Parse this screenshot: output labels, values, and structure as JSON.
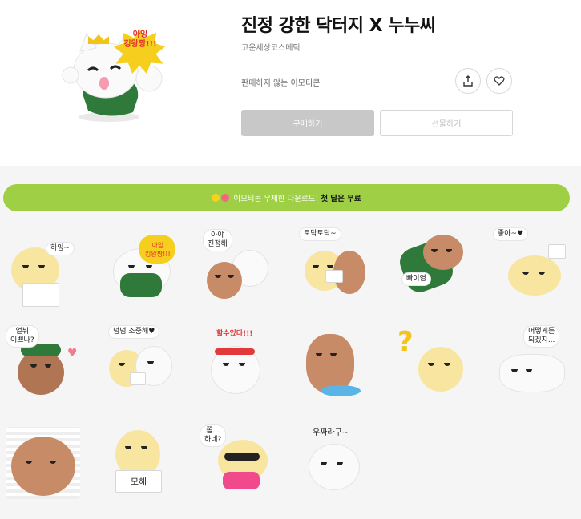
{
  "product": {
    "title": "진정 강한 닥터지 X 누누씨",
    "author": "고운세상코스메틱",
    "status": "판매하지 않는 이모티콘",
    "buy_label": "구매하기",
    "gift_label": "선물하기",
    "hero_burst_text": "아잉\n킹왕짱!!!"
  },
  "banner": {
    "text": "이모티콘 무제한 다운로드!",
    "highlight": "첫 달은 무료"
  },
  "stickers": [
    {
      "bubble": "하잉~"
    },
    {
      "bubble": "아잉\n킹왕짱!!!"
    },
    {
      "bubble": "아야\n진정해"
    },
    {
      "bubble": "토닥토닥~"
    },
    {
      "bubble": "빠이염"
    },
    {
      "bubble": "좋아~♥"
    },
    {
      "bubble": "얼붜\n이쁘나?"
    },
    {
      "bubble": "넘넘 소중해♥"
    },
    {
      "bubble": "할수있다!!!"
    },
    {
      "bubble": ""
    },
    {
      "bubble": ""
    },
    {
      "bubble": "어떻게든\n되겠지..."
    },
    {
      "bubble": ""
    },
    {
      "bubble": "모해"
    },
    {
      "bubble": "쫌...\n하네?"
    },
    {
      "bubble": "우짜라구~"
    }
  ],
  "icons": {
    "share": "share-icon",
    "like": "heart-icon"
  },
  "colors": {
    "banner_bg": "#9ecf45",
    "buy_bg": "#c8c8c8",
    "content_bg": "#f5f5f5"
  }
}
